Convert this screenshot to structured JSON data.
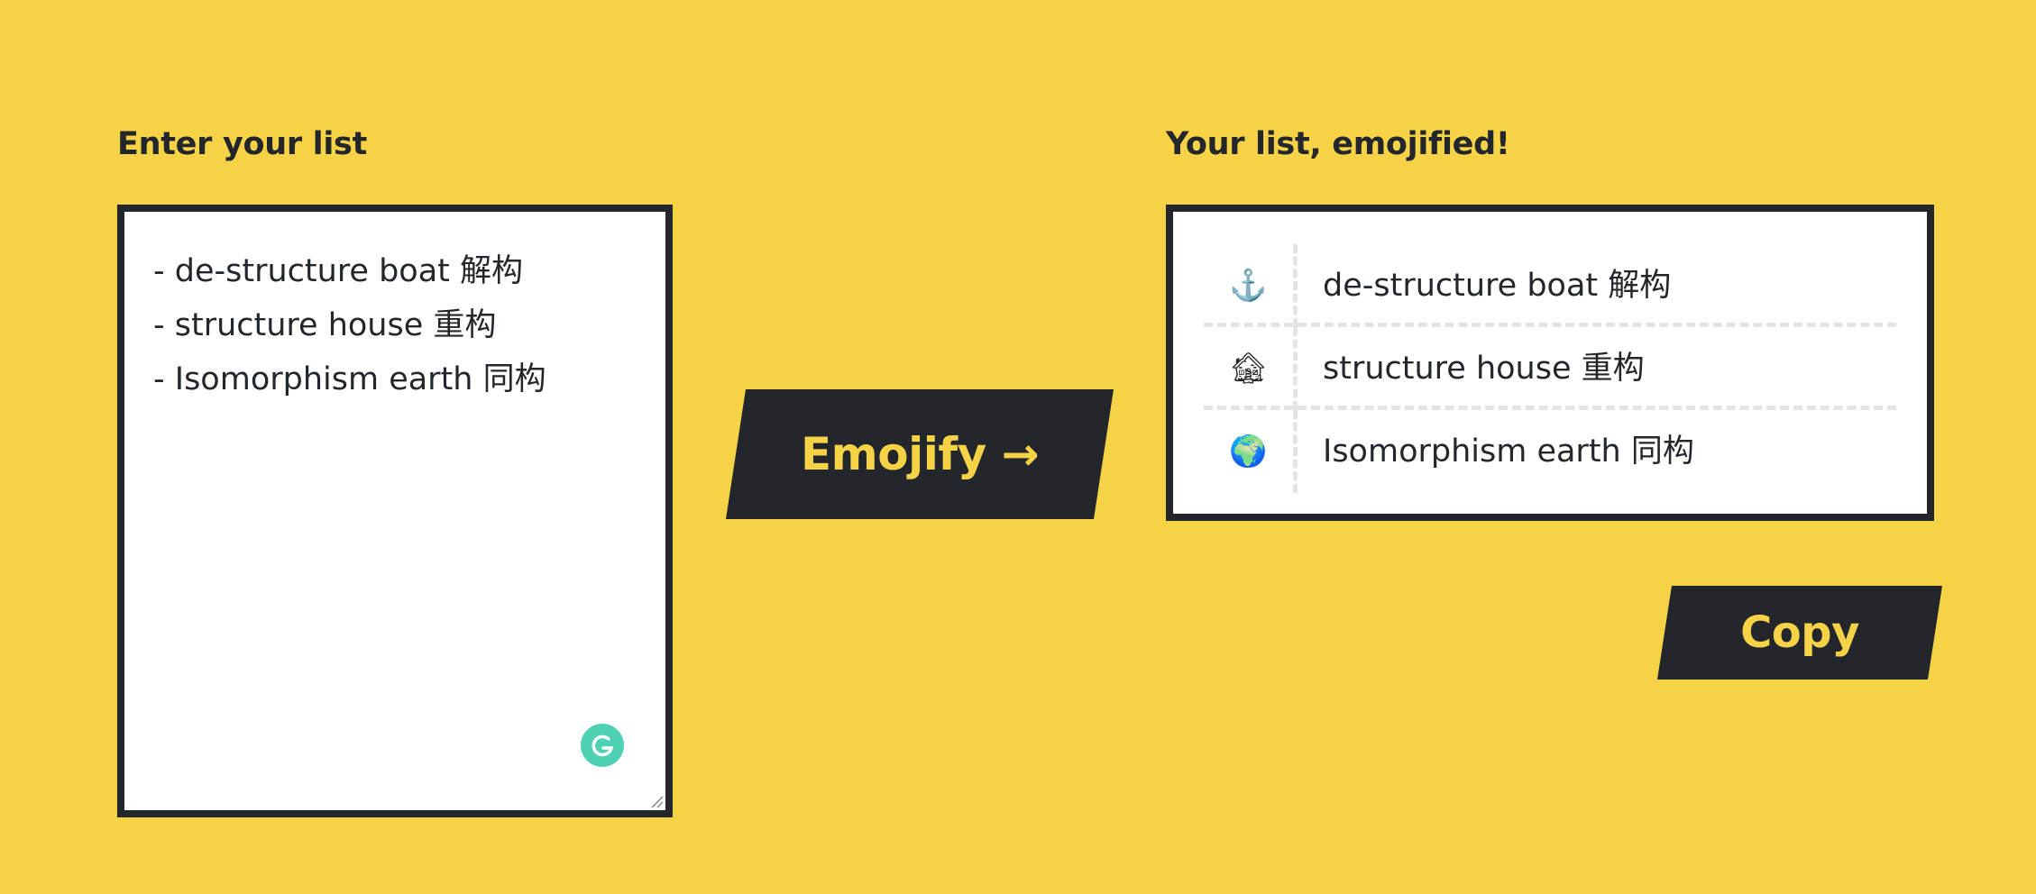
{
  "input": {
    "label": "Enter your list",
    "lines": [
      "- de-structure boat 解构",
      "- structure house 重构",
      "- Isomorphism earth 同构"
    ]
  },
  "emojify_button": {
    "label": "Emojify →"
  },
  "output": {
    "label": "Your list, emojified!",
    "items": [
      {
        "emoji": "⚓",
        "icon": "anchor-icon",
        "text": "de-structure boat 解构"
      },
      {
        "emoji": "🏚",
        "icon": "house-icon",
        "text": "structure house 重构"
      },
      {
        "emoji": "🌍",
        "icon": "earth-globe-icon",
        "text": "Isomorphism earth 同构"
      }
    ]
  },
  "copy_button": {
    "label": "Copy"
  },
  "colors": {
    "background": "#F6D247",
    "dark": "#23272B",
    "accent_text": "#F6D247",
    "grammarly": "#15C39A"
  }
}
